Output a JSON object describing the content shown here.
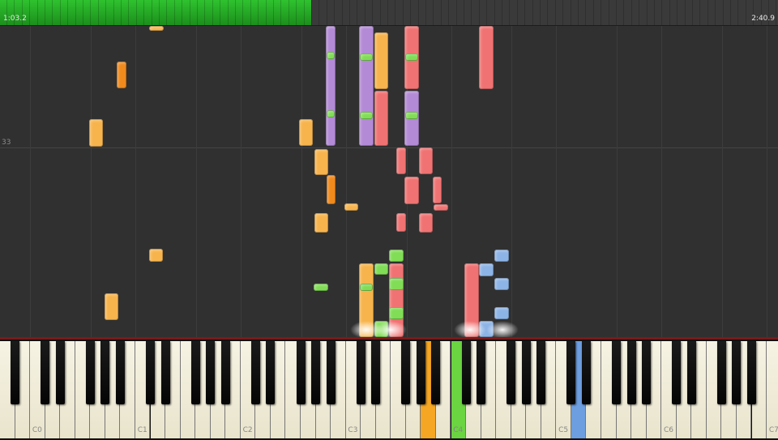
{
  "player": {
    "elapsed_time": "1:03.2",
    "total_time": "2:40.9",
    "progress_fraction": 0.4,
    "measure_number": "33"
  },
  "keyboard": {
    "octave_labels": [
      "C0",
      "C1",
      "C2",
      "C3",
      "C4",
      "C5",
      "C6",
      "C7"
    ],
    "pressed_key_colors": {
      "orange": "#f5a623",
      "green": "#6ad441",
      "red": "#f26b6b",
      "blue": "#6c9ee0"
    }
  },
  "colors": {
    "track_orange": "#f7b44d",
    "track_dark_orange": "#f08a1c",
    "track_green": "#80dd55",
    "track_red": "#f07272",
    "track_purple": "#b38ad6",
    "track_blue": "#8db4e6",
    "progress_green": "#22a922",
    "keyboard_rim": "#7a1a1a"
  }
}
